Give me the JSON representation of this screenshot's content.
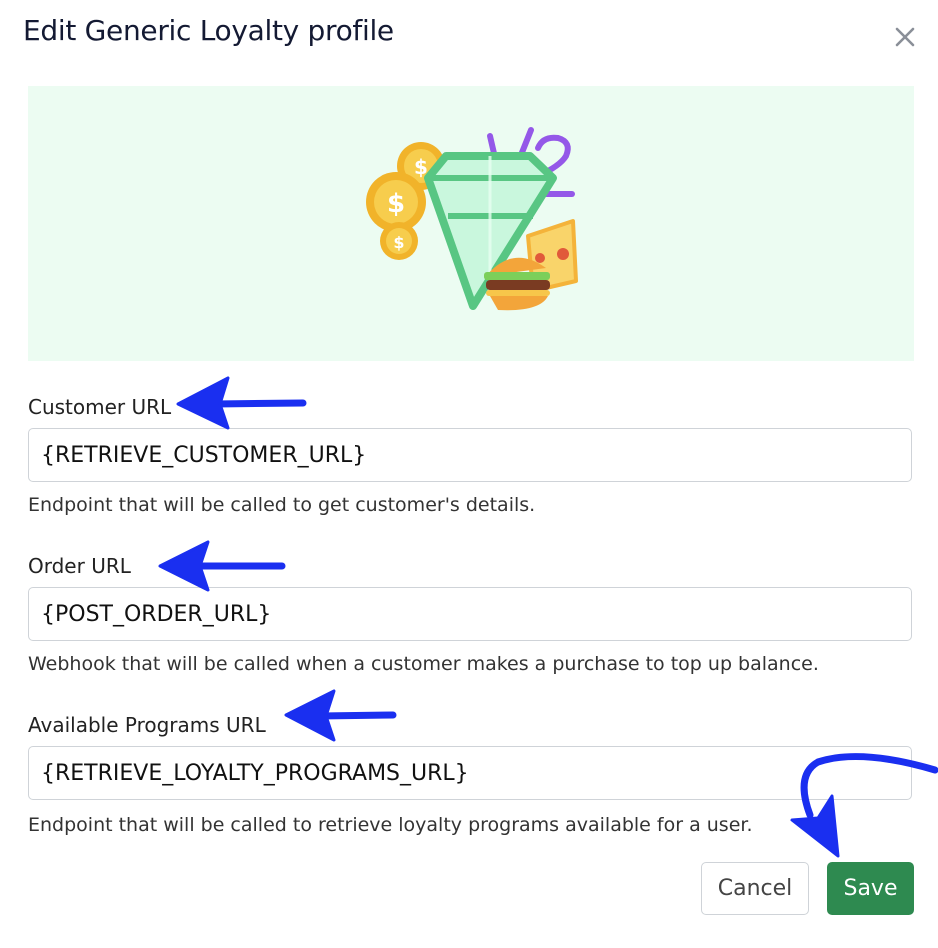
{
  "dialog": {
    "title": "Edit Generic Loyalty profile",
    "close_icon": "close-icon"
  },
  "hero": {
    "illustration": "loyalty-diamond-coins-food-illustration",
    "background": "#ecfcf2"
  },
  "fields": {
    "customer": {
      "label": "Customer URL",
      "value": "{RETRIEVE_CUSTOMER_URL}",
      "help": "Endpoint that will be called to get customer's details."
    },
    "order": {
      "label": "Order URL",
      "value": "{POST_ORDER_URL}",
      "help": "Webhook that will be called when a customer makes a purchase to top up balance."
    },
    "programs": {
      "label": "Available Programs URL",
      "value": "{RETRIEVE_LOYALTY_PROGRAMS_URL}",
      "help": "Endpoint that will be called to retrieve loyalty programs available for a user."
    }
  },
  "buttons": {
    "cancel": "Cancel",
    "save": "Save"
  },
  "colors": {
    "primary": "#2e8a50",
    "annotation_arrow": "#1a2ff0"
  }
}
